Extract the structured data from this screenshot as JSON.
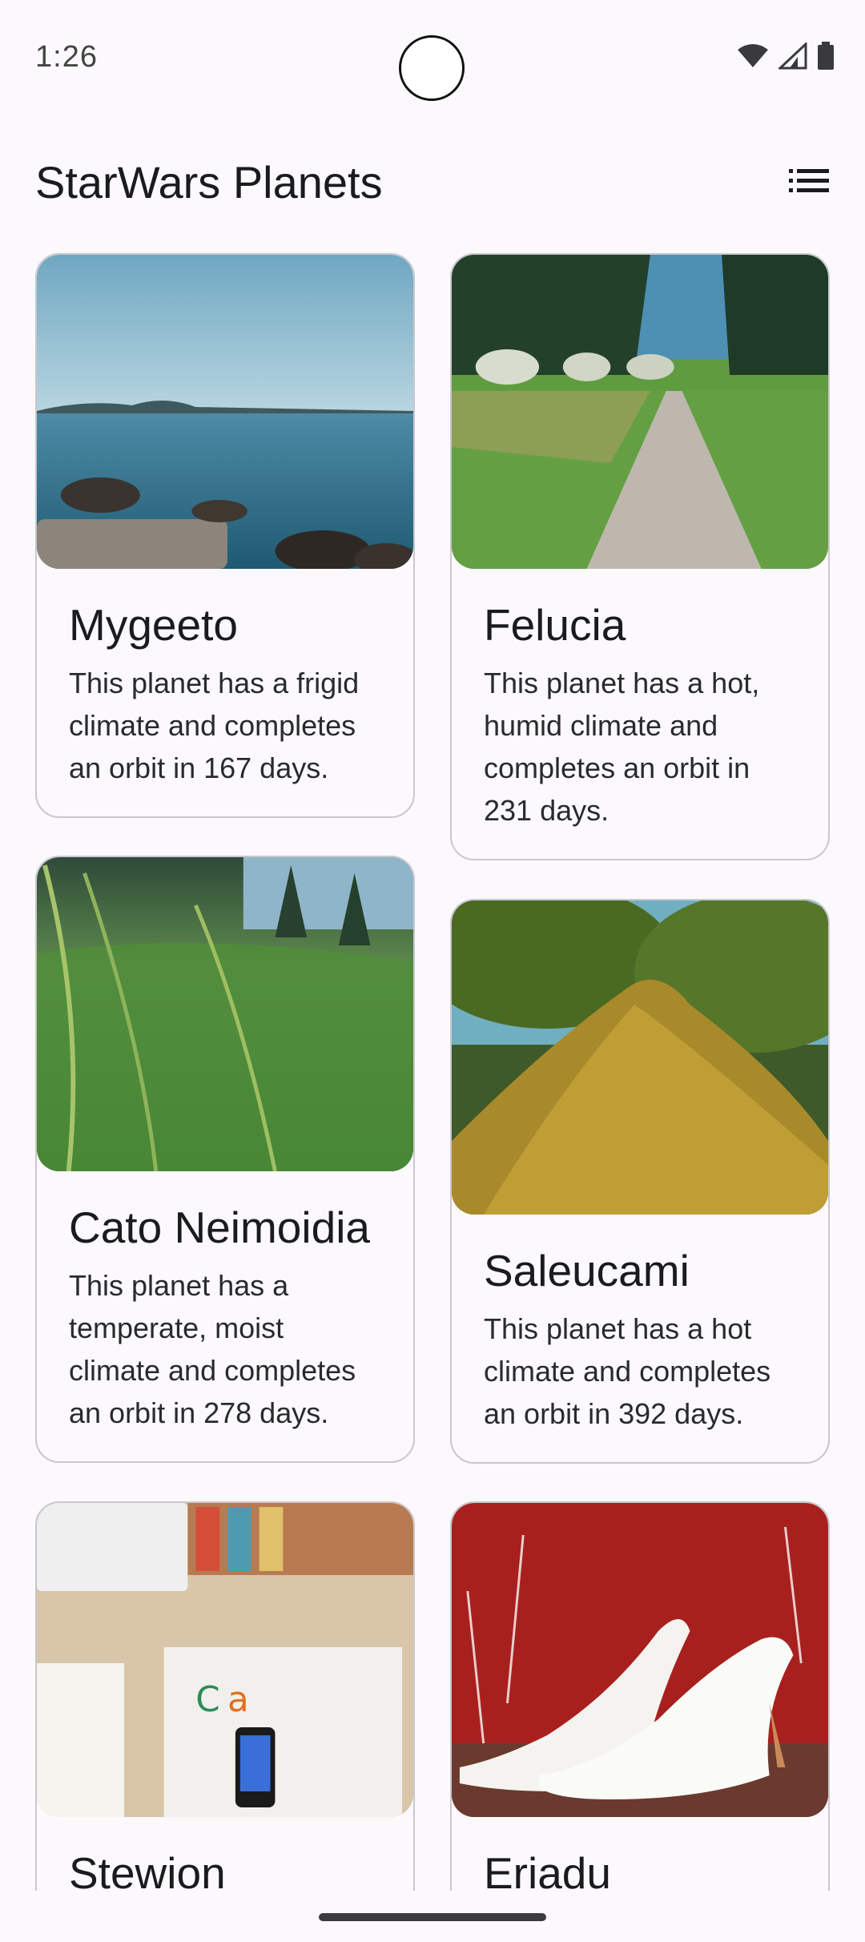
{
  "status": {
    "time": "1:26",
    "icons": [
      "wifi-icon",
      "signal-icon",
      "battery-icon"
    ]
  },
  "app_bar": {
    "title": "StarWars Planets",
    "menu_icon": "list-view-icon"
  },
  "planets": [
    {
      "name": "Mygeeto",
      "description": "This planet has a frigid climate and completes an orbit in 167 days.",
      "image": "lake-shore"
    },
    {
      "name": "Felucia",
      "description": "This planet has a hot, humid climate and completes an orbit in 231 days.",
      "image": "grass-path"
    },
    {
      "name": "Cato Neimoidia",
      "description": "This planet has a temperate, moist climate and completes an orbit in 278 days.",
      "image": "tall-grass"
    },
    {
      "name": "Saleucami",
      "description": "This planet has a hot climate and completes an orbit in 392 days.",
      "image": "mossy-branch"
    },
    {
      "name": "Stewion",
      "description": "",
      "image": "desk-workspace"
    },
    {
      "name": "Eriadu",
      "description": "",
      "image": "white-heels"
    }
  ],
  "colors": {
    "background": "#FBF9FC",
    "card_border": "#C9C6CE",
    "text": "#1B1B1F"
  }
}
